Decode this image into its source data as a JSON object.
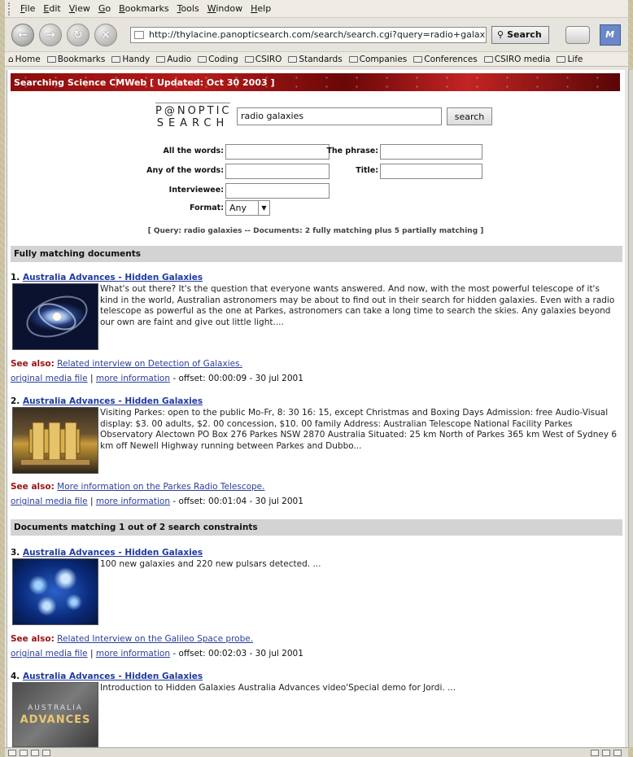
{
  "menu": [
    "File",
    "Edit",
    "View",
    "Go",
    "Bookmarks",
    "Tools",
    "Window",
    "Help"
  ],
  "menu_underline": [
    "F",
    "E",
    "V",
    "G",
    "B",
    "T",
    "W",
    "H"
  ],
  "menu_rest": [
    "ile",
    "dit",
    "iew",
    "o",
    "ookmarks",
    "ools",
    "indow",
    "elp"
  ],
  "nav": {
    "url": "http://thylacine.panopticsearch.com/search/search.cgi?query=radio+galaxies&coll",
    "search_label": "Search",
    "throbber": "M"
  },
  "bookmarks": [
    "Home",
    "Bookmarks",
    "Handy",
    "Audio",
    "Coding",
    "CSIRO",
    "Standards",
    "Companies",
    "Conferences",
    "CSIRO media",
    "Life"
  ],
  "page": {
    "banner": "Searching Science CMWeb [ Updated: Oct 30 2003 ]",
    "logo_line1": "P@NOPTIC",
    "logo_line2": "SEARCH",
    "query_value": "radio galaxies",
    "search_button": "search",
    "labels": {
      "all_words": "All the words:",
      "phrase": "The phrase:",
      "any_words": "Any of the words:",
      "title": "Title:",
      "interviewee": "Interviewee:",
      "format": "Format:"
    },
    "format_value": "Any",
    "summary": "[ Query: radio galaxies -- Documents: 2 fully matching plus 5 partially matching ]",
    "section_full": "Fully matching documents",
    "section_partial": "Documents matching 1 out of 2 search constraints",
    "see_also_label": "See also:",
    "original_media": "original media file",
    "more_info": "more information",
    "results": [
      {
        "num": "1.",
        "title": "Australia Advances - Hidden Galaxies",
        "snippet": "What's out there? It's the question that everyone wants answered. And now, with the most powerful telescope of it's kind in the world, Australian astronomers may be about to find out in their search for hidden galaxies. Even with a radio telescope as powerful as the one at Parkes, astronomers can take a long time to search the skies. Any galaxies beyond our own are faint and give out little light....",
        "see_also": "Related interview on Detection of Galaxies.",
        "offset": " - offset: 00:00:09 - 30 jul 2001"
      },
      {
        "num": "2.",
        "title": "Australia Advances - Hidden Galaxies",
        "snippet": "Visiting Parkes: open to the public Mo-Fr, 8: 30 16: 15, except Christmas and Boxing Days Admission: free Audio-Visual display: $3. 00 adults, $2. 00 concession, $10. 00 family Address: Australian Telescope National Facility Parkes Observatory Alectown PO Box 276 Parkes NSW 2870 Australia Situated: 25 km North of Parkes 365 km West of Sydney 6 km off Newell Highway running between Parkes and Dubbo...",
        "see_also": "More information on the Parkes Radio Telescope.",
        "offset": " - offset: 00:01:04 - 30 jul 2001"
      },
      {
        "num": "3.",
        "title": "Australia Advances - Hidden Galaxies",
        "snippet": "100 new galaxies and 220 new pulsars detected. ...",
        "see_also": "Related Interview on the Galileo Space probe.",
        "offset": " - offset: 00:02:03 - 30 jul 2001"
      },
      {
        "num": "4.",
        "title": "Australia Advances - Hidden Galaxies",
        "snippet": "Introduction to Hidden Galaxies Australia Advances video'Special demo for Jordi. ...",
        "thumb_text1": "AUSTRALIA",
        "thumb_text2": "ADVANCES"
      }
    ]
  },
  "colors": {
    "link": "#1f3aa0",
    "see_also": "#9a1010",
    "banner": "#8a0d0d",
    "section": "#d3d3d3"
  }
}
